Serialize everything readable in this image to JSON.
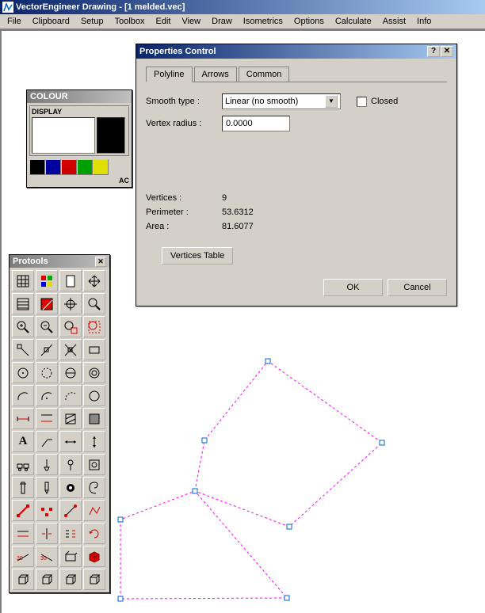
{
  "titlebar": {
    "app": "VectorEngineer Drawing",
    "doc": "[1 melded.vec]"
  },
  "menu": [
    "File",
    "Clipboard",
    "Setup",
    "Toolbox",
    "Edit",
    "View",
    "Draw",
    "Isometrics",
    "Options",
    "Calculate",
    "Assist",
    "Info"
  ],
  "colour": {
    "title": "COLOUR",
    "display_label": "DISPLAY",
    "ac_label": "AC",
    "palette": [
      "#000000",
      "#0000a0",
      "#d00000",
      "#00a000",
      "#e0e000"
    ]
  },
  "protools": {
    "title": "Protools"
  },
  "dialog": {
    "title": "Properties Control",
    "tabs": [
      "Polyline",
      "Arrows",
      "Common"
    ],
    "smooth_label": "Smooth type :",
    "smooth_value": "Linear (no smooth)",
    "closed_label": "Closed",
    "vrad_label": "Vertex radius :",
    "vrad_value": "0.0000",
    "vertices_label": "Vertices :",
    "vertices_value": "9",
    "perimeter_label": "Perimeter :",
    "perimeter_value": "53.6312",
    "area_label": "Area :",
    "area_value": "81.6077",
    "vt_btn": "Vertices Table",
    "ok": "OK",
    "cancel": "Cancel"
  }
}
